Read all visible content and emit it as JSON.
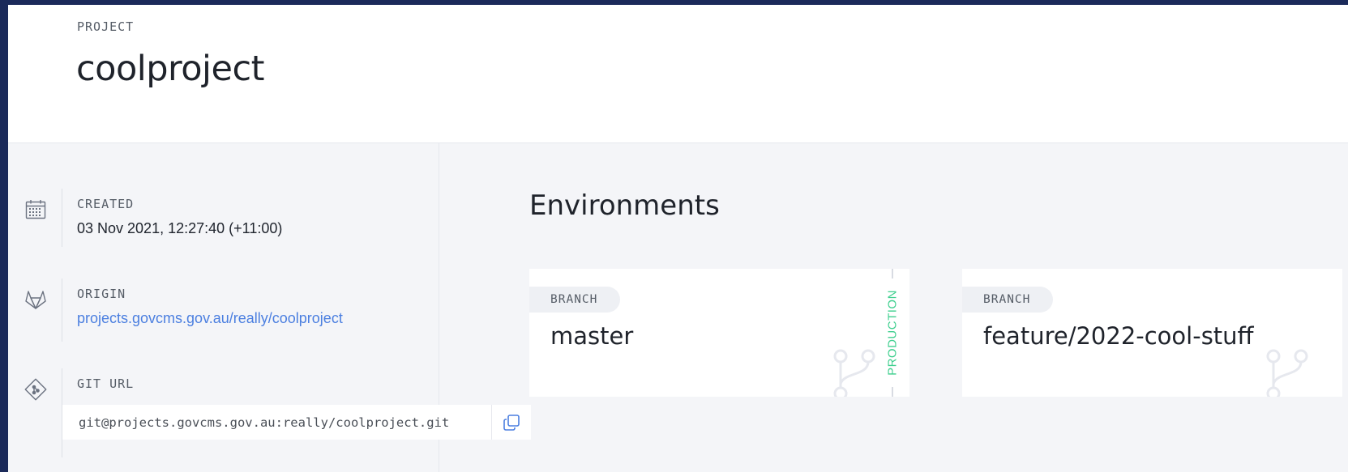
{
  "project": {
    "eyebrow": "PROJECT",
    "name": "coolproject"
  },
  "details": {
    "created": {
      "label": "CREATED",
      "value": "03 Nov 2021, 12:27:40 (+11:00)",
      "icon": "calendar-icon"
    },
    "origin": {
      "label": "ORIGIN",
      "value": "projects.govcms.gov.au/really/coolproject",
      "icon": "gitlab-icon"
    },
    "git_url": {
      "label": "GIT URL",
      "value": "git@projects.govcms.gov.au:really/coolproject.git",
      "icon": "git-icon",
      "copy_icon": "copy-icon"
    }
  },
  "environments": {
    "heading": "Environments",
    "cards": [
      {
        "eyebrow": "BRANCH",
        "name": "master",
        "type": "PRODUCTION"
      },
      {
        "eyebrow": "BRANCH",
        "name": "feature/2022-cool-stuff",
        "type": ""
      }
    ]
  },
  "colors": {
    "link": "#4b7fe0",
    "production": "#3ecf8e",
    "frame": "#1b2a5a"
  }
}
